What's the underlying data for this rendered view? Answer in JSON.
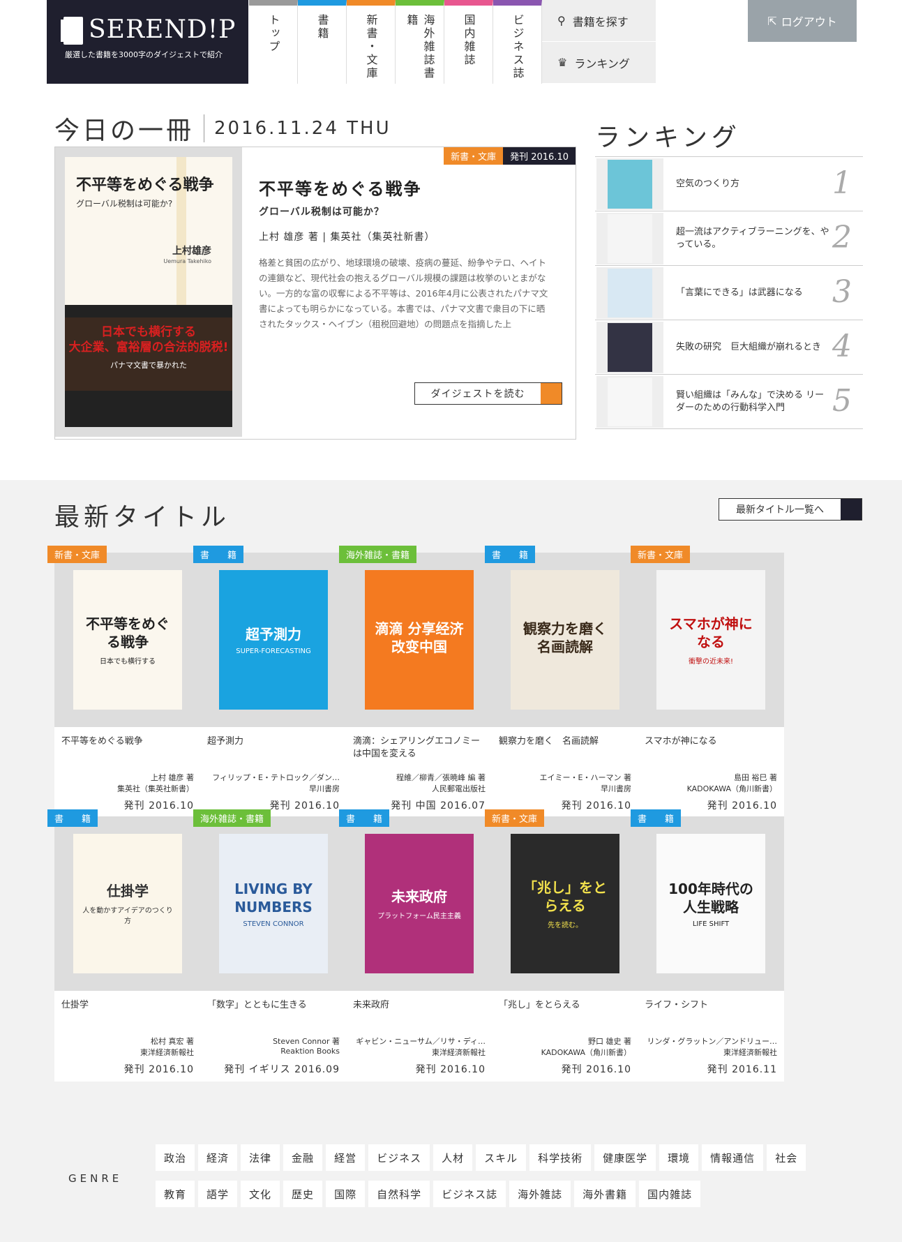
{
  "header": {
    "logo_title": "SEREND!P",
    "logo_tagline": "厳選した書籍を3000字のダイジェストで紹介",
    "nav": [
      {
        "label": "トップ",
        "color": "#9a9a9a"
      },
      {
        "label": "書籍",
        "color": "#1f9ae0"
      },
      {
        "label": "新書・文庫",
        "color": "#f08a28"
      },
      {
        "label": "海外雑誌書籍",
        "color": "#6cbf3a"
      },
      {
        "label": "国内雑誌",
        "color": "#e8578f"
      },
      {
        "label": "ビジネス誌",
        "color": "#8a56b0"
      }
    ],
    "search_label": "書籍を探す",
    "ranking_label": "ランキング",
    "logout_label": "ログアウト"
  },
  "today": {
    "heading": "今日の一冊",
    "date": "2016.11.24 THU",
    "category": "新書・文庫",
    "published": "発刊 2016.10",
    "title": "不平等をめぐる戦争",
    "subtitle": "グローバル税制は可能か？",
    "author_line": "上村 雄彦 著 | 集英社（集英社新書）",
    "description": "格差と貧困の広がり、地球環境の破壊、疫病の蔓延、紛争やテロ、ヘイトの連鎖など、現代社会の抱えるグローバル規模の課題は枚挙のいとまがない。一方的な富の収奪による不平等は、2016年4月に公表されたパナマ文書によっても明らかになっている。本書では、パナマ文書で衆目の下に晒されたタックス・ヘイブン（租税回避地）の問題点を指摘した上",
    "read_button": "ダイジェストを読む",
    "cover": {
      "title": "不平等をめぐる戦争",
      "subtitle": "グローバル税制は可能か?",
      "author": "上村雄彦",
      "author_en": "Uemura Takehiko",
      "band_line1": "日本でも横行する",
      "band_line2": "大企業、富裕層の合法的脱税!",
      "band_line3": "パナマ文書で暴かれた"
    }
  },
  "ranking": {
    "heading": "ランキング",
    "items": [
      {
        "title": "空気のつくり方",
        "num": "1",
        "color": "#6cc5d8"
      },
      {
        "title": "超一流はアクティブラーニングを、やっている。",
        "num": "2",
        "color": "#f5f5f5"
      },
      {
        "title": "「言葉にできる」は武器になる",
        "num": "3",
        "color": "#d8e8f3"
      },
      {
        "title": "失敗の研究　巨大組織が崩れるとき",
        "num": "4",
        "color": "#333344"
      },
      {
        "title": "賢い組織は「みんな」で決める リーダーのための行動科学入門",
        "num": "5",
        "color": "#f7f7f7"
      }
    ]
  },
  "latest": {
    "heading": "最新タイトル",
    "all_button": "最新タイトル一覧へ",
    "cards": [
      {
        "category": "新書・文庫",
        "tagcolor": "#f08a28",
        "title": "不平等をめぐる戦争",
        "author": "上村 雄彦 著",
        "publisher": "集英社（集英社新書）",
        "date": "発刊 2016.10",
        "cover_title": "不平等をめぐる戦争",
        "cover_sub": "日本でも横行する",
        "cover_bg": "#fbf7ee",
        "cover_fg": "#222"
      },
      {
        "category": "書　　籍",
        "tagcolor": "#1f9ae0",
        "title": "超予測力",
        "author": "フィリップ・E・テトロック／ダン…",
        "publisher": "早川書房",
        "date": "発刊 2016.10",
        "cover_title": "超予測力",
        "cover_sub": "SUPER-FORECASTING",
        "cover_bg": "#1aa3e0",
        "cover_fg": "#fff"
      },
      {
        "category": "海外雑誌・書籍",
        "tagcolor": "#6cbf3a",
        "title": "滴滴：シェアリングエコノミーは中国を変える",
        "author": "程維／柳青／張暁峰 編 著",
        "publisher": "人民郵電出版社",
        "date": "発刊 中国 2016.07",
        "cover_title": "滴滴 分享经济改变中国",
        "cover_sub": "",
        "cover_bg": "#f47a20",
        "cover_fg": "#fff"
      },
      {
        "category": "書　　籍",
        "tagcolor": "#1f9ae0",
        "title": "観察力を磨く　名画読解",
        "author": "エイミー・E・ハーマン 著",
        "publisher": "早川書房",
        "date": "発刊 2016.10",
        "cover_title": "観察力を磨く 名画読解",
        "cover_sub": "",
        "cover_bg": "#efe8dc",
        "cover_fg": "#3a2a1a"
      },
      {
        "category": "新書・文庫",
        "tagcolor": "#f08a28",
        "title": "スマホが神になる",
        "author": "島田 裕巳 著",
        "publisher": "KADOKAWA（角川新書）",
        "date": "発刊 2016.10",
        "cover_title": "スマホが神になる",
        "cover_sub": "衝撃の近未来!",
        "cover_bg": "#f4f4f4",
        "cover_fg": "#c01010"
      },
      {
        "category": "書　　籍",
        "tagcolor": "#1f9ae0",
        "title": "仕掛学",
        "author": "松村 真宏 著",
        "publisher": "東洋経済新報社",
        "date": "発刊 2016.10",
        "cover_title": "仕掛学",
        "cover_sub": "人を動かすアイデアのつくり方",
        "cover_bg": "#fbf6ea",
        "cover_fg": "#333"
      },
      {
        "category": "海外雑誌・書籍",
        "tagcolor": "#6cbf3a",
        "title": "「数字」とともに生きる",
        "author": "Steven Connor 著",
        "publisher": "Reaktion Books",
        "date": "発刊 イギリス 2016.09",
        "cover_title": "LIVING BY NUMBERS",
        "cover_sub": "STEVEN CONNOR",
        "cover_bg": "#e9eef5",
        "cover_fg": "#2a5a9a"
      },
      {
        "category": "書　　籍",
        "tagcolor": "#1f9ae0",
        "title": "未来政府",
        "author": "ギャビン・ニューサム／リサ・ディ…",
        "publisher": "東洋経済新報社",
        "date": "発刊 2016.10",
        "cover_title": "未来政府",
        "cover_sub": "プラットフォーム民主主義",
        "cover_bg": "#b0307a",
        "cover_fg": "#fff"
      },
      {
        "category": "新書・文庫",
        "tagcolor": "#f08a28",
        "title": "「兆し」をとらえる",
        "author": "野口 雄史 著",
        "publisher": "KADOKAWA（角川新書）",
        "date": "発刊 2016.10",
        "cover_title": "「兆し」をとらえる",
        "cover_sub": "先を読む。",
        "cover_bg": "#2a2a2a",
        "cover_fg": "#f2e14c"
      },
      {
        "category": "書　　籍",
        "tagcolor": "#1f9ae0",
        "title": "ライフ・シフト",
        "author": "リンダ・グラットン／アンドリュー…",
        "publisher": "東洋経済新報社",
        "date": "発刊 2016.11",
        "cover_title": "100年時代の人生戦略",
        "cover_sub": "LIFE SHIFT",
        "cover_bg": "#fafafa",
        "cover_fg": "#222"
      }
    ]
  },
  "genre": {
    "label": "GENRE",
    "row1": [
      "政治",
      "経済",
      "法律",
      "金融",
      "経営",
      "ビジネス",
      "人材",
      "スキル",
      "科学技術",
      "健康医学",
      "環境",
      "情報通信",
      "社会"
    ],
    "row2": [
      "教育",
      "語学",
      "文化",
      "歴史",
      "国際",
      "自然科学",
      "ビジネス誌",
      "海外雑誌",
      "海外書籍",
      "国内雑誌"
    ]
  }
}
